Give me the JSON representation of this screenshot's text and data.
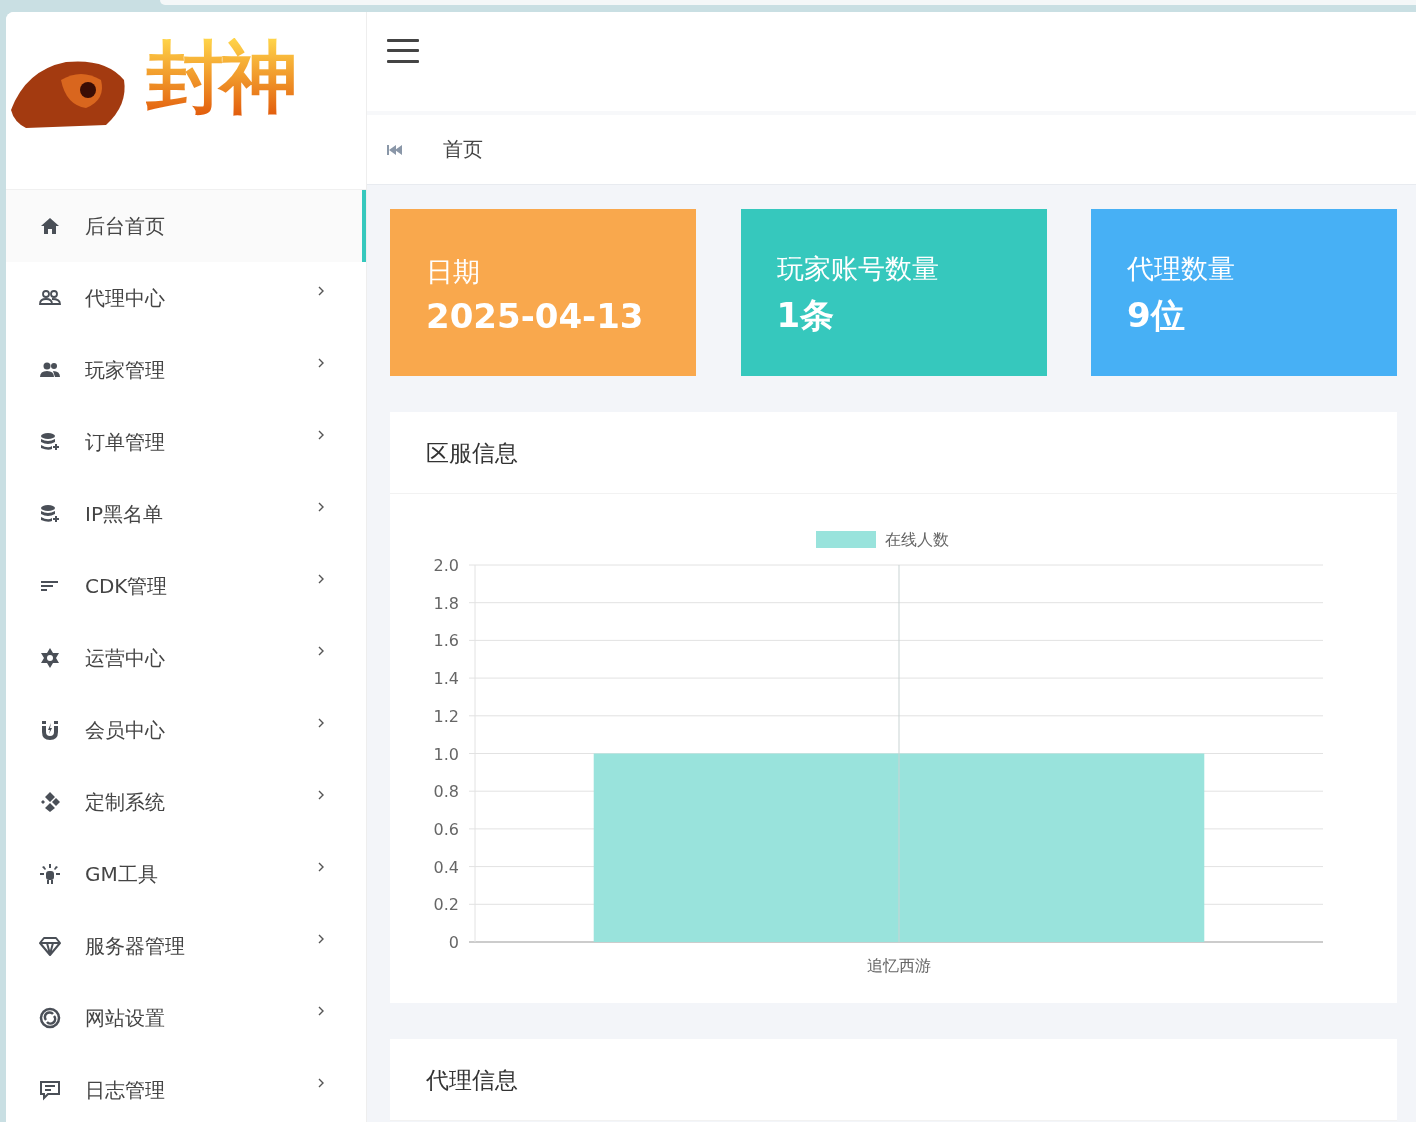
{
  "logo": {
    "text": "封神"
  },
  "sidebar": {
    "items": [
      {
        "label": "后台首页",
        "selected": true,
        "expandable": false
      },
      {
        "label": "代理中心",
        "selected": false,
        "expandable": true
      },
      {
        "label": "玩家管理",
        "selected": false,
        "expandable": true
      },
      {
        "label": "订单管理",
        "selected": false,
        "expandable": true
      },
      {
        "label": "IP黑名单",
        "selected": false,
        "expandable": true
      },
      {
        "label": "CDK管理",
        "selected": false,
        "expandable": true
      },
      {
        "label": "运营中心",
        "selected": false,
        "expandable": true
      },
      {
        "label": "会员中心",
        "selected": false,
        "expandable": true
      },
      {
        "label": "定制系统",
        "selected": false,
        "expandable": true
      },
      {
        "label": "GM工具",
        "selected": false,
        "expandable": true
      },
      {
        "label": "服务器管理",
        "selected": false,
        "expandable": true
      },
      {
        "label": "网站设置",
        "selected": false,
        "expandable": true
      },
      {
        "label": "日志管理",
        "selected": false,
        "expandable": true
      }
    ]
  },
  "breadcrumb": {
    "items": [
      "首页"
    ]
  },
  "stats": [
    {
      "label": "日期",
      "value": "2025-04-13",
      "color": "#f9a84d"
    },
    {
      "label": "玩家账号数量",
      "value": "1条",
      "color": "#36c8bd"
    },
    {
      "label": "代理数量",
      "value": "9位",
      "color": "#47b0f5"
    }
  ],
  "panels": [
    {
      "title": "区服信息",
      "chart_data": {
        "type": "bar",
        "grid": true,
        "categories": [
          "追忆西游"
        ],
        "series": [
          {
            "name": "在线人数",
            "color": "#99e3dc",
            "values": [
              1
            ]
          }
        ],
        "ylim": [
          0,
          2
        ],
        "yticks": [
          {
            "value": 0,
            "label": "0"
          },
          {
            "value": 0.2,
            "label": "0.2"
          },
          {
            "value": 0.4,
            "label": "0.4"
          },
          {
            "value": 0.6,
            "label": "0.6"
          },
          {
            "value": 0.8,
            "label": "0.8"
          },
          {
            "value": 1,
            "label": "1.0"
          },
          {
            "value": 1.2,
            "label": "1.2"
          },
          {
            "value": 1.4,
            "label": "1.4"
          },
          {
            "value": 1.6,
            "label": "1.6"
          },
          {
            "value": 1.8,
            "label": "1.8"
          },
          {
            "value": 2,
            "label": "2.0"
          }
        ]
      }
    },
    {
      "title": "代理信息"
    }
  ]
}
